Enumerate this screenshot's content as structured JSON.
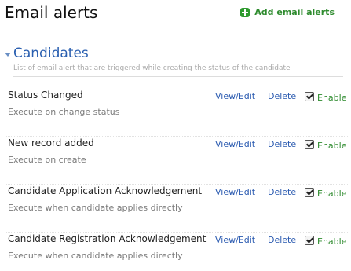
{
  "page": {
    "title": "Email alerts",
    "add_button": {
      "label": "Add email alerts",
      "icon": "plus-icon",
      "color": "#2e8b2e"
    }
  },
  "section": {
    "title": "Candidates",
    "description": "List of email alert that are triggered while creating the status of the candidate",
    "expanded": true
  },
  "alerts": [
    {
      "name": "Status Changed",
      "execute": "Execute on change status",
      "view_edit": "View/Edit",
      "delete": "Delete",
      "enable": "Enable",
      "enabled": true
    },
    {
      "name": "New record added",
      "execute": "Execute on create",
      "view_edit": "View/Edit",
      "delete": "Delete",
      "enable": "Enable",
      "enabled": true
    },
    {
      "name": "Candidate Application Acknowledgement",
      "execute": "Execute when candidate applies directly",
      "view_edit": "View/Edit",
      "delete": "Delete",
      "enable": "Enable",
      "enabled": true
    },
    {
      "name": "Candidate Registration Acknowledgement",
      "execute": "Execute when candidate applies directly",
      "view_edit": "View/Edit",
      "delete": "Delete",
      "enable": "Enable",
      "enabled": true
    }
  ],
  "colors": {
    "link": "#2a5ab0",
    "enable": "#2e8b2e",
    "section_title": "#2a5fb0"
  }
}
